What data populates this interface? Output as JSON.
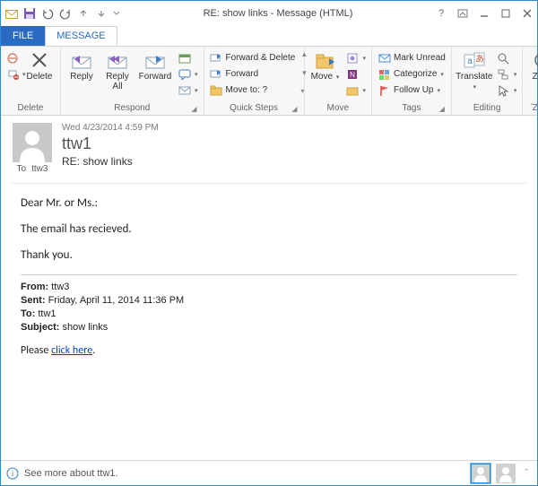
{
  "window": {
    "title": "RE: show links - Message (HTML)"
  },
  "tabs": {
    "file": "FILE",
    "message": "MESSAGE"
  },
  "ribbon": {
    "delete_group": "Delete",
    "delete": "Delete",
    "respond_group": "Respond",
    "reply": "Reply",
    "reply_all": "Reply\nAll",
    "forward": "Forward",
    "quicksteps_group": "Quick Steps",
    "forward_delete": "Forward & Delete",
    "forward2": "Forward",
    "move_to": "Move to: ?",
    "move_group": "Move",
    "move": "Move",
    "tags_group": "Tags",
    "mark_unread": "Mark Unread",
    "categorize": "Categorize",
    "follow_up": "Follow Up",
    "editing_group": "Editing",
    "translate": "Translate",
    "zoom_group": "Zoom",
    "zoom": "Zoom"
  },
  "header": {
    "date": "Wed 4/23/2014 4:59 PM",
    "from": "ttw1",
    "subject": "RE: show links",
    "to_label": "To",
    "to_value": "ttw3"
  },
  "body": {
    "p1": "Dear Mr. or Ms.:",
    "p2": "The email has recieved.",
    "p3": "Thank you.",
    "quoted": {
      "from_label": "From:",
      "from": "ttw3",
      "sent_label": "Sent:",
      "sent": "Friday, April 11, 2014 11:36 PM",
      "to_label": "To:",
      "to": "ttw1",
      "subject_label": "Subject:",
      "subject": "show links",
      "text_prefix": "Please ",
      "link_text": "click here",
      "text_suffix": "."
    }
  },
  "status": {
    "see_more": "See more about ttw1."
  }
}
